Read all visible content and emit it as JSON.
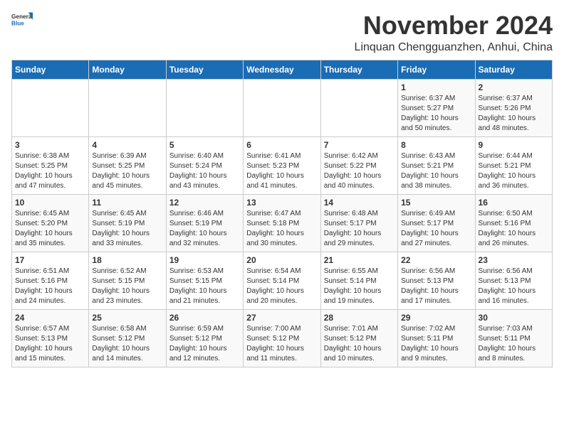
{
  "logo": {
    "general": "General",
    "blue": "Blue"
  },
  "title": "November 2024",
  "location": "Linquan Chengguanzhen, Anhui, China",
  "days_of_week": [
    "Sunday",
    "Monday",
    "Tuesday",
    "Wednesday",
    "Thursday",
    "Friday",
    "Saturday"
  ],
  "weeks": [
    [
      {
        "day": "",
        "info": ""
      },
      {
        "day": "",
        "info": ""
      },
      {
        "day": "",
        "info": ""
      },
      {
        "day": "",
        "info": ""
      },
      {
        "day": "",
        "info": ""
      },
      {
        "day": "1",
        "info": "Sunrise: 6:37 AM\nSunset: 5:27 PM\nDaylight: 10 hours\nand 50 minutes."
      },
      {
        "day": "2",
        "info": "Sunrise: 6:37 AM\nSunset: 5:26 PM\nDaylight: 10 hours\nand 48 minutes."
      }
    ],
    [
      {
        "day": "3",
        "info": "Sunrise: 6:38 AM\nSunset: 5:25 PM\nDaylight: 10 hours\nand 47 minutes."
      },
      {
        "day": "4",
        "info": "Sunrise: 6:39 AM\nSunset: 5:25 PM\nDaylight: 10 hours\nand 45 minutes."
      },
      {
        "day": "5",
        "info": "Sunrise: 6:40 AM\nSunset: 5:24 PM\nDaylight: 10 hours\nand 43 minutes."
      },
      {
        "day": "6",
        "info": "Sunrise: 6:41 AM\nSunset: 5:23 PM\nDaylight: 10 hours\nand 41 minutes."
      },
      {
        "day": "7",
        "info": "Sunrise: 6:42 AM\nSunset: 5:22 PM\nDaylight: 10 hours\nand 40 minutes."
      },
      {
        "day": "8",
        "info": "Sunrise: 6:43 AM\nSunset: 5:21 PM\nDaylight: 10 hours\nand 38 minutes."
      },
      {
        "day": "9",
        "info": "Sunrise: 6:44 AM\nSunset: 5:21 PM\nDaylight: 10 hours\nand 36 minutes."
      }
    ],
    [
      {
        "day": "10",
        "info": "Sunrise: 6:45 AM\nSunset: 5:20 PM\nDaylight: 10 hours\nand 35 minutes."
      },
      {
        "day": "11",
        "info": "Sunrise: 6:45 AM\nSunset: 5:19 PM\nDaylight: 10 hours\nand 33 minutes."
      },
      {
        "day": "12",
        "info": "Sunrise: 6:46 AM\nSunset: 5:19 PM\nDaylight: 10 hours\nand 32 minutes."
      },
      {
        "day": "13",
        "info": "Sunrise: 6:47 AM\nSunset: 5:18 PM\nDaylight: 10 hours\nand 30 minutes."
      },
      {
        "day": "14",
        "info": "Sunrise: 6:48 AM\nSunset: 5:17 PM\nDaylight: 10 hours\nand 29 minutes."
      },
      {
        "day": "15",
        "info": "Sunrise: 6:49 AM\nSunset: 5:17 PM\nDaylight: 10 hours\nand 27 minutes."
      },
      {
        "day": "16",
        "info": "Sunrise: 6:50 AM\nSunset: 5:16 PM\nDaylight: 10 hours\nand 26 minutes."
      }
    ],
    [
      {
        "day": "17",
        "info": "Sunrise: 6:51 AM\nSunset: 5:16 PM\nDaylight: 10 hours\nand 24 minutes."
      },
      {
        "day": "18",
        "info": "Sunrise: 6:52 AM\nSunset: 5:15 PM\nDaylight: 10 hours\nand 23 minutes."
      },
      {
        "day": "19",
        "info": "Sunrise: 6:53 AM\nSunset: 5:15 PM\nDaylight: 10 hours\nand 21 minutes."
      },
      {
        "day": "20",
        "info": "Sunrise: 6:54 AM\nSunset: 5:14 PM\nDaylight: 10 hours\nand 20 minutes."
      },
      {
        "day": "21",
        "info": "Sunrise: 6:55 AM\nSunset: 5:14 PM\nDaylight: 10 hours\nand 19 minutes."
      },
      {
        "day": "22",
        "info": "Sunrise: 6:56 AM\nSunset: 5:13 PM\nDaylight: 10 hours\nand 17 minutes."
      },
      {
        "day": "23",
        "info": "Sunrise: 6:56 AM\nSunset: 5:13 PM\nDaylight: 10 hours\nand 16 minutes."
      }
    ],
    [
      {
        "day": "24",
        "info": "Sunrise: 6:57 AM\nSunset: 5:13 PM\nDaylight: 10 hours\nand 15 minutes."
      },
      {
        "day": "25",
        "info": "Sunrise: 6:58 AM\nSunset: 5:12 PM\nDaylight: 10 hours\nand 14 minutes."
      },
      {
        "day": "26",
        "info": "Sunrise: 6:59 AM\nSunset: 5:12 PM\nDaylight: 10 hours\nand 12 minutes."
      },
      {
        "day": "27",
        "info": "Sunrise: 7:00 AM\nSunset: 5:12 PM\nDaylight: 10 hours\nand 11 minutes."
      },
      {
        "day": "28",
        "info": "Sunrise: 7:01 AM\nSunset: 5:12 PM\nDaylight: 10 hours\nand 10 minutes."
      },
      {
        "day": "29",
        "info": "Sunrise: 7:02 AM\nSunset: 5:11 PM\nDaylight: 10 hours\nand 9 minutes."
      },
      {
        "day": "30",
        "info": "Sunrise: 7:03 AM\nSunset: 5:11 PM\nDaylight: 10 hours\nand 8 minutes."
      }
    ]
  ]
}
